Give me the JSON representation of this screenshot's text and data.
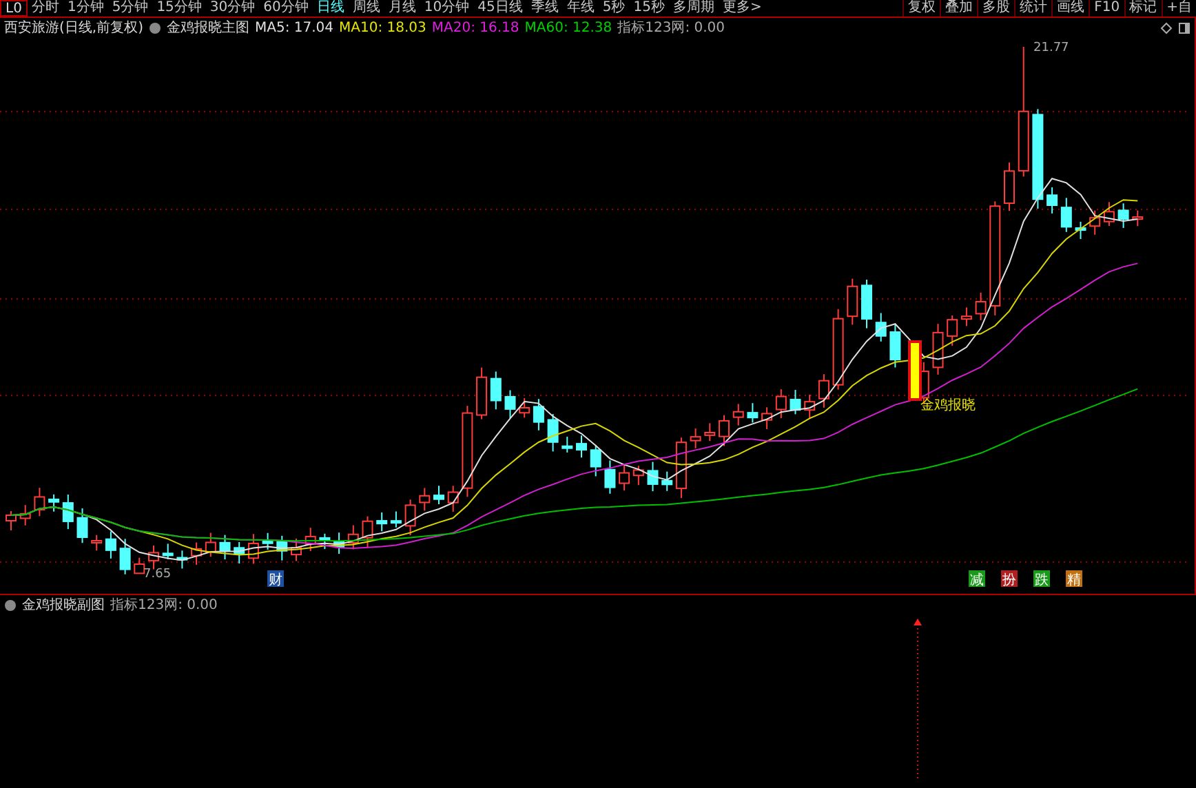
{
  "toolbar": {
    "period_box": "L0",
    "tabs": [
      {
        "label": "分时",
        "selected": false
      },
      {
        "label": "1分钟",
        "selected": false
      },
      {
        "label": "5分钟",
        "selected": false
      },
      {
        "label": "15分钟",
        "selected": false
      },
      {
        "label": "30分钟",
        "selected": false
      },
      {
        "label": "60分钟",
        "selected": false
      },
      {
        "label": "日线",
        "selected": true
      },
      {
        "label": "周线",
        "selected": false
      },
      {
        "label": "月线",
        "selected": false
      },
      {
        "label": "10分钟",
        "selected": false
      },
      {
        "label": "45日线",
        "selected": false
      },
      {
        "label": "季线",
        "selected": false
      },
      {
        "label": "年线",
        "selected": false
      },
      {
        "label": "5秒",
        "selected": false
      },
      {
        "label": "15秒",
        "selected": false
      },
      {
        "label": "多周期",
        "selected": false
      },
      {
        "label": "更多>",
        "selected": false
      }
    ],
    "right_buttons": [
      "复权",
      "叠加",
      "多股",
      "统计",
      "画线",
      "F10",
      "标记",
      "+自"
    ]
  },
  "legend": {
    "stock": "西安旅游(日线,前复权)",
    "indicator": "金鸡报晓主图",
    "averages": [
      {
        "label": "MA5: 17.04",
        "color": "#e0e0e0"
      },
      {
        "label": "MA10: 18.03",
        "color": "#e6e600"
      },
      {
        "label": "MA20: 16.18",
        "color": "#e020e0"
      },
      {
        "label": "MA60: 12.38",
        "color": "#00d000"
      }
    ],
    "indicator_value": "指标123网: 0.00"
  },
  "main_chart": {
    "high_label": "21.77",
    "low_label": "7.65",
    "signal_label": "金鸡报晓",
    "event_marks": [
      {
        "label": "财",
        "color": "#2050a0"
      }
    ],
    "badges": [
      {
        "label": "减",
        "color": "#1a9a1a"
      },
      {
        "label": "扮",
        "color": "#b02020"
      },
      {
        "label": "跌",
        "color": "#1a9a1a"
      },
      {
        "label": "精",
        "color": "#c07010"
      }
    ]
  },
  "sub_panel": {
    "indicator": "金鸡报晓副图",
    "indicator_value": "指标123网: 0.00"
  }
}
